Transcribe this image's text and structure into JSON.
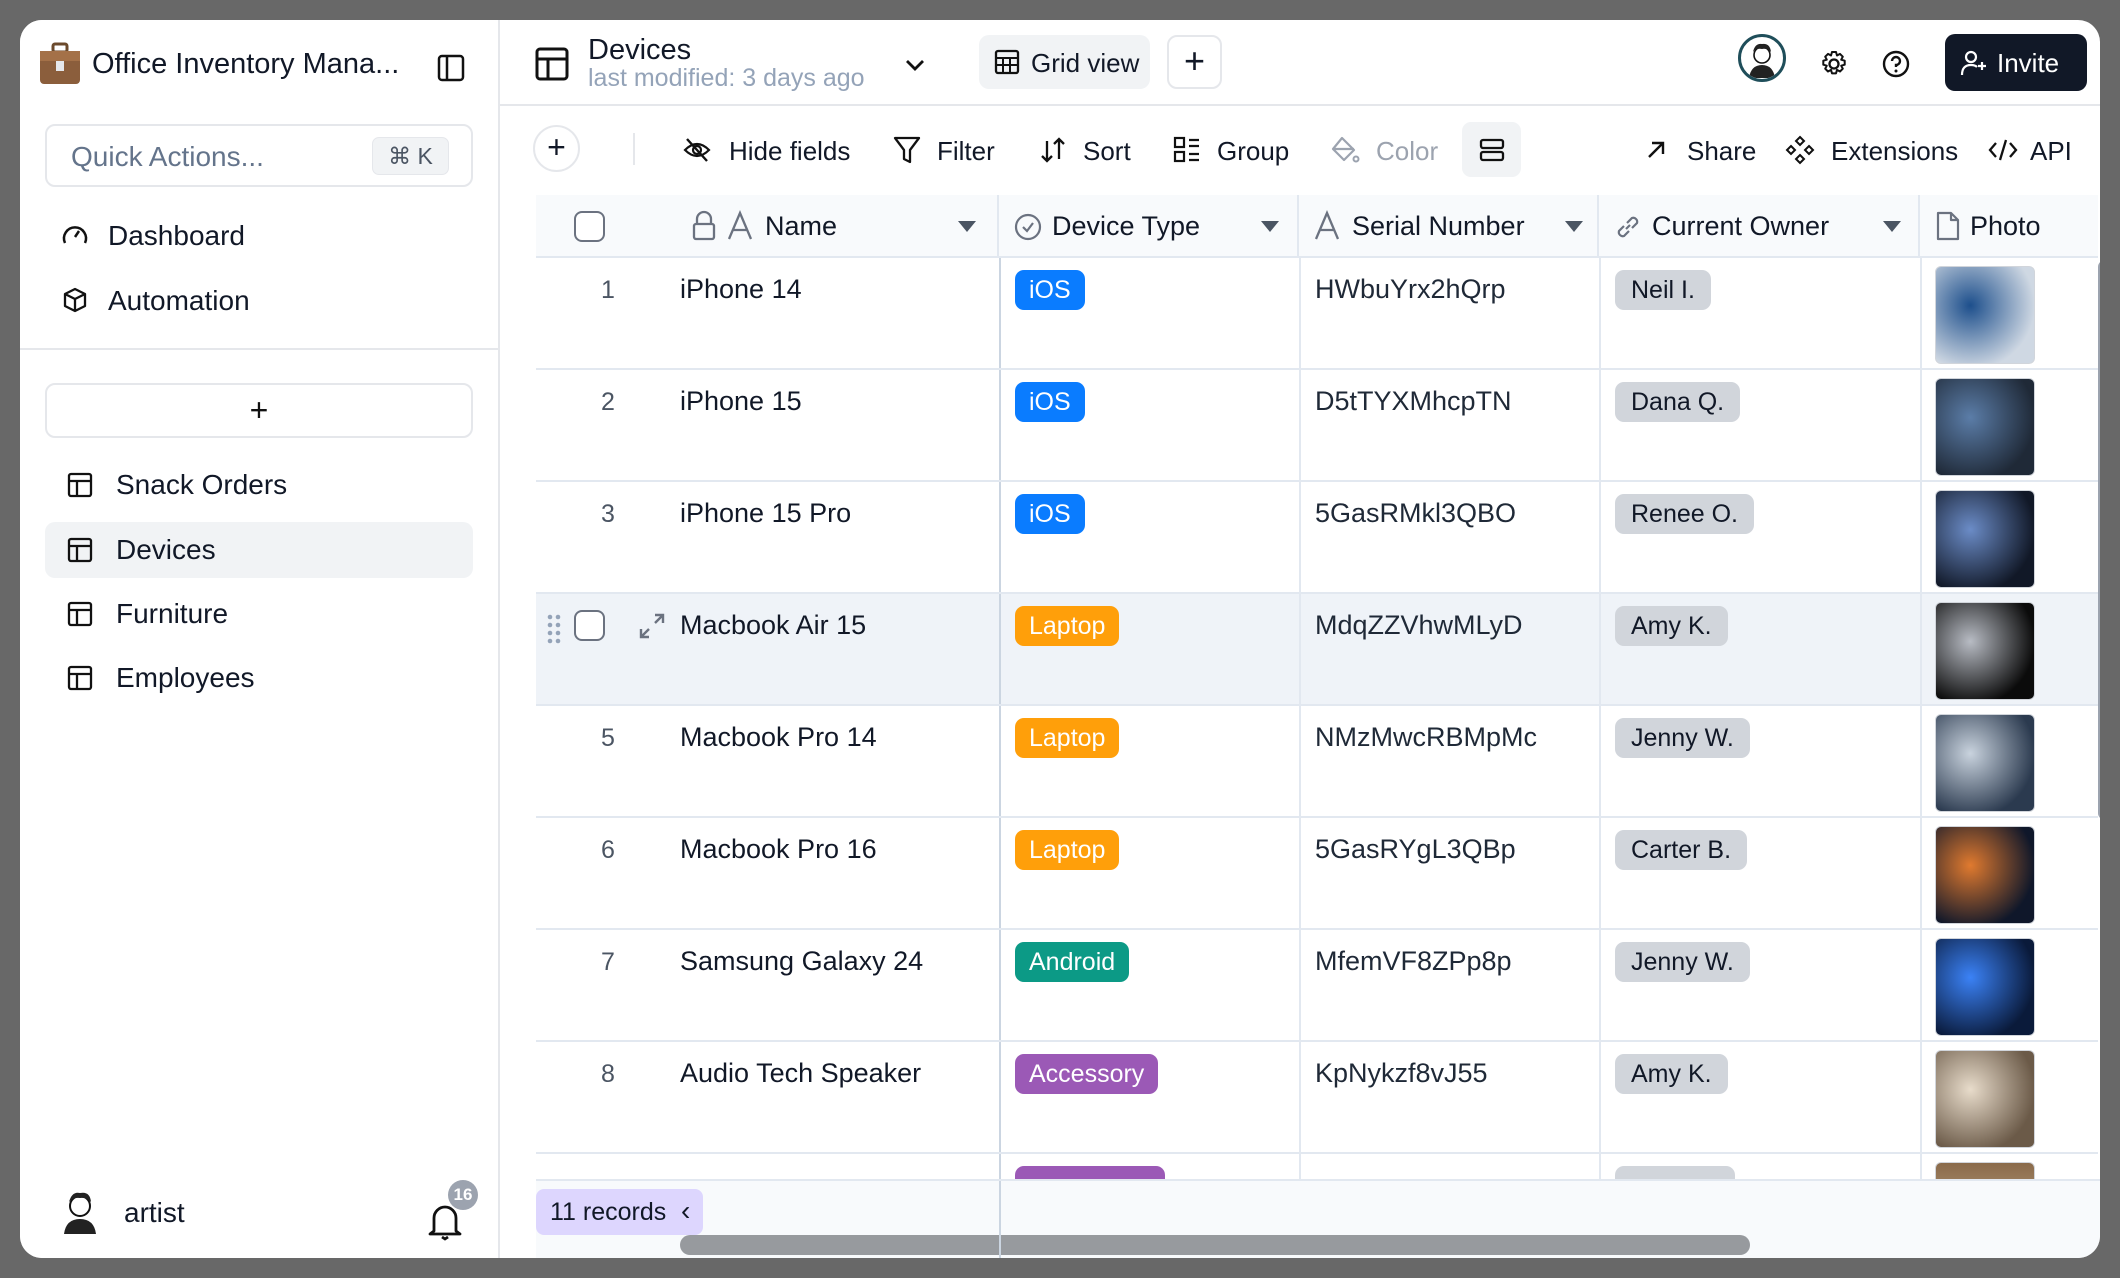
{
  "sidebar": {
    "workspace_title": "Office Inventory Mana...",
    "quick_actions_placeholder": "Quick Actions...",
    "quick_actions_shortcut": "⌘ K",
    "nav": [
      {
        "label": "Dashboard",
        "icon": "gauge-icon"
      },
      {
        "label": "Automation",
        "icon": "cube-icon"
      }
    ],
    "add_label": "+",
    "tables": [
      {
        "label": "Snack Orders",
        "active": false
      },
      {
        "label": "Devices",
        "active": true
      },
      {
        "label": "Furniture",
        "active": false
      },
      {
        "label": "Employees",
        "active": false
      }
    ],
    "user": {
      "name": "artist",
      "notifications": "16"
    }
  },
  "header": {
    "table_title": "Devices",
    "subtitle": "last modified: 3 days ago",
    "view_label": "Grid view",
    "add_view": "+",
    "invite_label": "Invite"
  },
  "toolbar": {
    "add": "+",
    "hide_fields": "Hide fields",
    "filter": "Filter",
    "sort": "Sort",
    "group": "Group",
    "color": "Color",
    "share": "Share",
    "extensions": "Extensions",
    "api": "API"
  },
  "table": {
    "columns": [
      {
        "label": "Name",
        "icon": "text-icon"
      },
      {
        "label": "Device Type",
        "icon": "check-circle-icon"
      },
      {
        "label": "Serial Number",
        "icon": "text-icon"
      },
      {
        "label": "Current Owner",
        "icon": "link-icon"
      },
      {
        "label": "Photo",
        "icon": "file-icon"
      }
    ],
    "badge_colors": {
      "iOS": "#0a7cff",
      "Laptop": "#ff9f0a",
      "Android": "#0c9a86",
      "Accessory": "#9b59b6"
    },
    "rows": [
      {
        "num": "1",
        "name": "iPhone 14",
        "type": "iOS",
        "serial": "HWbuYrx2hQrp",
        "owner": "Neil I.",
        "thumb": [
          "#cfd8e3",
          "#1d4f8c"
        ]
      },
      {
        "num": "2",
        "name": "iPhone 15",
        "type": "iOS",
        "serial": "D5tTYXMhcpTN",
        "owner": "Dana Q.",
        "thumb": [
          "#1f2937",
          "#5b7da8"
        ]
      },
      {
        "num": "3",
        "name": "iPhone 15 Pro",
        "type": "iOS",
        "serial": "5GasRMkl3QBO",
        "owner": "Renee O.",
        "thumb": [
          "#111827",
          "#6b8cc7"
        ]
      },
      {
        "num": "4",
        "name": "Macbook Air 15",
        "type": "Laptop",
        "serial": "MdqZZVhwMLyD",
        "owner": "Amy K.",
        "thumb": [
          "#0b0b0b",
          "#b8bcc4"
        ]
      },
      {
        "num": "5",
        "name": "Macbook Pro 14",
        "type": "Laptop",
        "serial": "NMzMwcRBMpMc",
        "owner": "Jenny W.",
        "thumb": [
          "#2b3a4f",
          "#c9d3de"
        ]
      },
      {
        "num": "6",
        "name": "Macbook Pro 16",
        "type": "Laptop",
        "serial": "5GasRYgL3QBp",
        "owner": "Carter B.",
        "thumb": [
          "#0f172a",
          "#e07a2f"
        ]
      },
      {
        "num": "7",
        "name": "Samsung Galaxy 24",
        "type": "Android",
        "serial": "MfemVF8ZPp8p",
        "owner": "Jenny W.",
        "thumb": [
          "#0a1a3a",
          "#3b82f6"
        ]
      },
      {
        "num": "8",
        "name": "Audio Tech Speaker",
        "type": "Accessory",
        "serial": "KpNykzf8vJ55",
        "owner": "Amy K.",
        "thumb": [
          "#6b5a48",
          "#e8dccb"
        ]
      }
    ]
  },
  "footer": {
    "records": "11 records",
    "collapse": "‹"
  }
}
